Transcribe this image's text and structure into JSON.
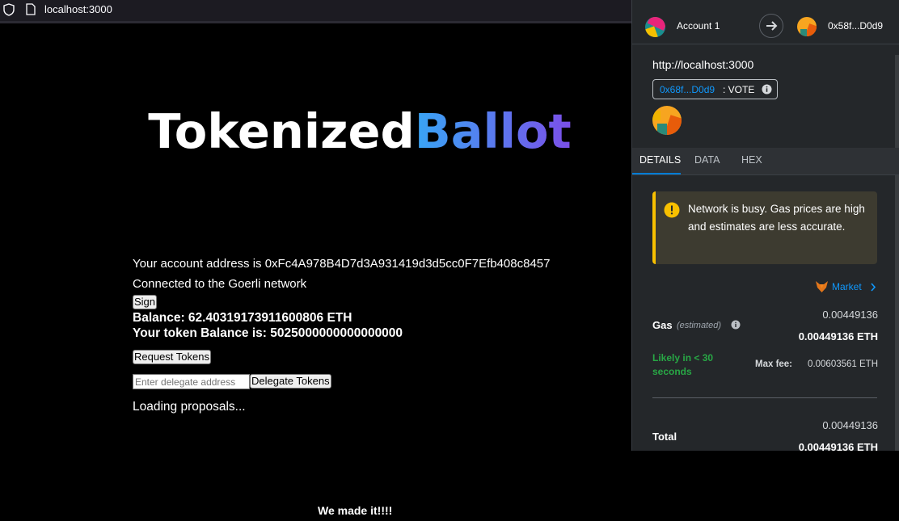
{
  "browser": {
    "url": "localhost:3000"
  },
  "app": {
    "title_part1": "Tokenized",
    "title_part2": "Ballot",
    "account_line": "Your account address is 0xFc4A978B4D7d3A931419d3d5cc0F7Efb408c8457",
    "network_line": "Connected to the Goerli network",
    "sign_label": "Sign",
    "balance_line": "Balance: 62.40319173911600806 ETH",
    "token_balance_line": "Your token Balance is: 5025000000000000000",
    "request_tokens_label": "Request Tokens",
    "delegate_placeholder": "Enter delegate address",
    "delegate_label": "Delegate Tokens",
    "loading_text": "Loading proposals...",
    "footer_text": "We made it!!!!"
  },
  "wallet": {
    "account_name": "Account 1",
    "to_address": "0x58f...D0d9",
    "origin": "http://localhost:3000",
    "contract_short": "0x68f...D0d9",
    "method": ": VOTE",
    "tabs": [
      "DETAILS",
      "DATA",
      "HEX"
    ],
    "warning": "Network is busy. Gas prices are high and estimates are less accurate.",
    "market_label": "Market",
    "gas_label": "Gas",
    "gas_estimated": "(estimated)",
    "gas_value": "0.00449136",
    "gas_value_eth": "0.00449136 ETH",
    "likely_text": "Likely in < 30 seconds",
    "max_fee_label": "Max fee:",
    "max_fee_value": "0.00603561 ETH",
    "total_label": "Total",
    "total_value": "0.00449136",
    "total_value_eth": "0.00449136 ETH"
  },
  "colors": {
    "accent_blue": "#037dd6",
    "link_blue": "#1098fc",
    "warning_yellow": "#f8c000",
    "success_green": "#28a745",
    "panel_bg": "#24272a"
  }
}
